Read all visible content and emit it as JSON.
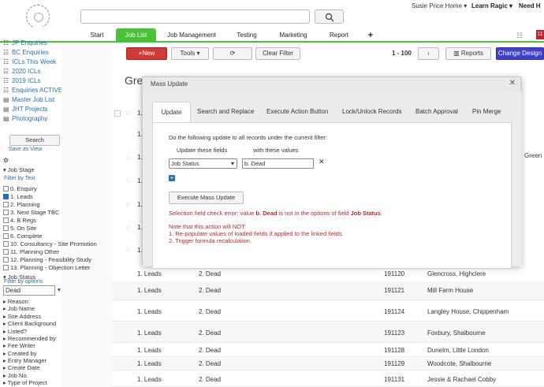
{
  "topbar": {
    "user": "Susie Price Home ▾",
    "learn": "Learn Ragic ▾",
    "need_help": "Need H"
  },
  "nav": {
    "tabs": [
      "Start",
      "Job List",
      "Job Management",
      "Testing",
      "Marketing",
      "Report",
      "+"
    ],
    "badge": "11"
  },
  "sidebar": {
    "saved_views": [
      "JP Enquiries",
      "BC Enquiries",
      "ICLs This Week",
      "2020 ICLs",
      "2019 ICLs",
      "Enquiries ACTIVE",
      "Master Job List",
      "JHT Projects",
      "Photography"
    ],
    "search_btn": "Search",
    "save_as_view": "Save as View",
    "job_stage_label": "Job Stage",
    "filter_by_text": "Filter by Text",
    "stages": [
      "0. Enquiry",
      "1. Leads",
      "2. Planning",
      "3. Next Stage TBC",
      "4. B Regs",
      "5. On Site",
      "6. Complete",
      "10. Consultancy - Site Promotion",
      "11. Planning Other",
      "12. Planning - Feasibility Study",
      "13. Planning - Objection Letter"
    ],
    "job_status_label": "Job Status",
    "filter_by_options": "Filter by options",
    "status_value": "Dead",
    "fields": [
      "Reason:",
      "Job Name",
      "Site Address",
      "Client Background",
      "Listed?",
      "Recommended by:",
      "Fee Writer",
      "Created by",
      "Entry Manager",
      "Create Date",
      "Job No.",
      "Type of Project"
    ]
  },
  "toolbar": {
    "new": "New",
    "tools": "Tools",
    "clear": "Clear Filter",
    "range": "1 - 100",
    "reports": "Reports",
    "change": "Change Design"
  },
  "page_title": "Gre",
  "right_snippet": "Green",
  "rows": [
    {
      "stage": "1. Leads",
      "status": "2. Dead",
      "no": "191120",
      "name": "Glencross, Highclere"
    },
    {
      "stage": "1. Leads",
      "status": "2. Dead",
      "no": "191121",
      "name": "Mill Farm House"
    },
    {
      "stage": "1. Leads",
      "status": "2. Dead",
      "no": "191124",
      "name": "Langley House, Chippenham"
    },
    {
      "stage": "1. Leads",
      "status": "2. Dead",
      "no": "191123",
      "name": "Foxbury, Shalbourne"
    },
    {
      "stage": "1. Leads",
      "status": "2. Dead",
      "no": "191128",
      "name": "Dunelm, Little London"
    },
    {
      "stage": "1. Leads",
      "status": "2. Dead",
      "no": "191129",
      "name": "Woodcote, Shalbourne"
    },
    {
      "stage": "1. Leads",
      "status": "2. Dead",
      "no": "191131",
      "name": "Jessie & Rachael Cobby"
    }
  ],
  "hidden_rows": [
    "1.",
    "1.",
    "1.",
    "1.",
    "1.",
    "1.",
    "1.",
    "1.",
    "1."
  ],
  "dialog": {
    "title": "Mass Update",
    "tabs": [
      "Update",
      "Search and Replace",
      "Execute Action Button",
      "Lock/Unlock Records",
      "Batch Approval",
      "Pin Merge"
    ],
    "instruction": "Do the following update to all records under the current filter:",
    "col1": "Update these fields",
    "col2": "with these values",
    "field": "Job Status",
    "value": "b. Dead",
    "execute": "Execute Mass Update",
    "err_pre": "Selection field check error: value ",
    "err_val": "b. Dead",
    "err_mid": " is not in the options of field ",
    "err_field": "Job Status",
    "err_end": ".",
    "note1": "Note that this action will NOT:",
    "note2": "1. Re-populate values of loaded fields if applied to the linked fields.",
    "note3": "2. Trigger formula recalculation."
  }
}
